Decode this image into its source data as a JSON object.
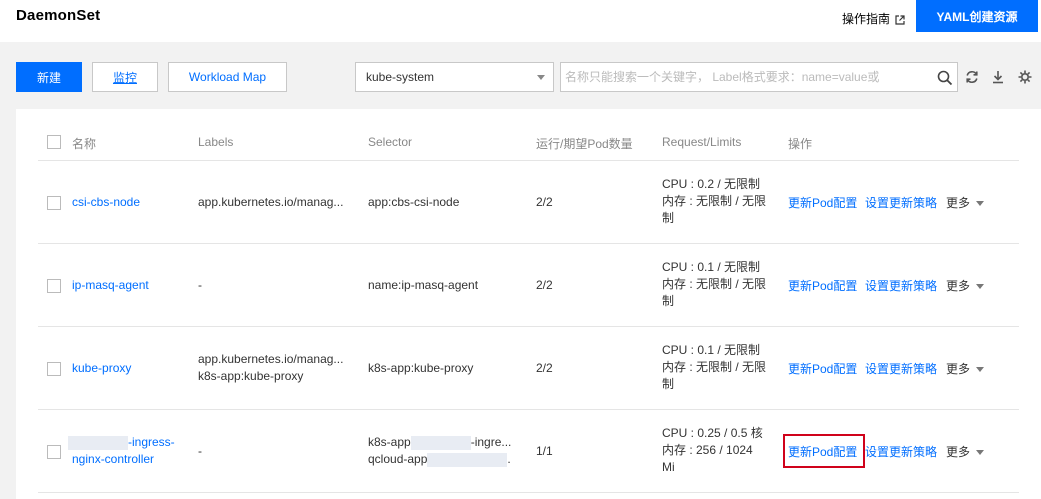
{
  "header": {
    "title": "DaemonSet",
    "guide_label": "操作指南",
    "yaml_button": "YAML创建资源"
  },
  "toolbar": {
    "new_button": "新建",
    "monitor_button": "监控",
    "workload_map_button": "Workload Map",
    "namespace": "kube-system",
    "search_placeholder": "名称只能搜索一个关键字， Label格式要求：name=value或"
  },
  "table": {
    "columns": [
      "名称",
      "Labels",
      "Selector",
      "运行/期望Pod数量",
      "Request/Limits",
      "操作"
    ],
    "rows": [
      {
        "name": "csi-cbs-node",
        "labels": [
          "app.kubernetes.io/manag..."
        ],
        "selector": [
          "app:cbs-csi-node"
        ],
        "pods": "2/2",
        "request_limits": [
          "CPU : 0.2 / 无限制",
          "内存 : 无限制 / 无限",
          "制"
        ],
        "action_update_pod": "更新Pod配置",
        "action_update_strategy": "设置更新策略",
        "action_more": "更多"
      },
      {
        "name": "ip-masq-agent",
        "labels": [
          "-"
        ],
        "selector": [
          "name:ip-masq-agent"
        ],
        "pods": "2/2",
        "request_limits": [
          "CPU : 0.1 / 无限制",
          "内存 : 无限制 / 无限",
          "制"
        ],
        "action_update_pod": "更新Pod配置",
        "action_update_strategy": "设置更新策略",
        "action_more": "更多"
      },
      {
        "name": "kube-proxy",
        "labels": [
          "app.kubernetes.io/manag...",
          "k8s-app:kube-proxy"
        ],
        "selector": [
          "k8s-app:kube-proxy"
        ],
        "pods": "2/2",
        "request_limits": [
          "CPU : 0.1 / 无限制",
          "内存 : 无限制 / 无限",
          "制"
        ],
        "action_update_pod": "更新Pod配置",
        "action_update_strategy": "设置更新策略",
        "action_more": "更多"
      },
      {
        "name_suffix": "-ingress-",
        "name_line2": "nginx-controller",
        "labels": [
          "-"
        ],
        "selector_prefix_1": "k8s-app",
        "selector_suffix_1": "-ingre...",
        "selector_prefix_2": "qcloud-app",
        "selector_suffix_2": ".",
        "pods": "1/1",
        "request_limits": [
          "CPU : 0.25 / 0.5 核",
          "内存 : 256 / 1024",
          "Mi"
        ],
        "action_update_pod": "更新Pod配置",
        "action_update_strategy": "设置更新策略",
        "action_more": "更多"
      }
    ]
  },
  "colors": {
    "accent": "#006eff",
    "highlight": "#d0021b"
  }
}
